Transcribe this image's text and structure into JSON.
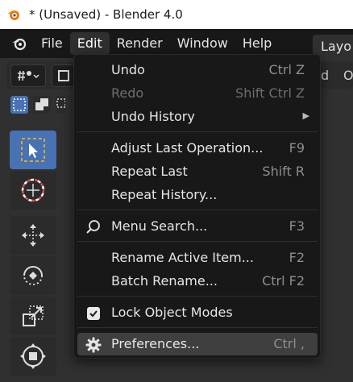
{
  "window": {
    "title": "* (Unsaved) - Blender 4.0"
  },
  "menubar": {
    "items": [
      "File",
      "Edit",
      "Render",
      "Window",
      "Help"
    ],
    "workspace_tab": "Layo"
  },
  "header": {
    "right_text_1": "d",
    "right_text_2": "O"
  },
  "edit_menu": {
    "items": [
      {
        "label": "Undo",
        "shortcut": "Ctrl Z"
      },
      {
        "label": "Redo",
        "shortcut": "Shift Ctrl Z"
      },
      {
        "label": "Undo History",
        "shortcut": ""
      },
      {
        "label": "Adjust Last Operation...",
        "shortcut": "F9"
      },
      {
        "label": "Repeat Last",
        "shortcut": "Shift R"
      },
      {
        "label": "Repeat History...",
        "shortcut": ""
      },
      {
        "label": "Menu Search...",
        "shortcut": "F3"
      },
      {
        "label": "Rename Active Item...",
        "shortcut": "F2"
      },
      {
        "label": "Batch Rename...",
        "shortcut": "Ctrl F2"
      },
      {
        "label": "Lock Object Modes",
        "shortcut": ""
      },
      {
        "label": "Preferences...",
        "shortcut": "Ctrl ,"
      }
    ]
  },
  "colors": {
    "accent": "#4772b3",
    "menu_bg": "#181818",
    "highlight": "#3f3f3f"
  }
}
